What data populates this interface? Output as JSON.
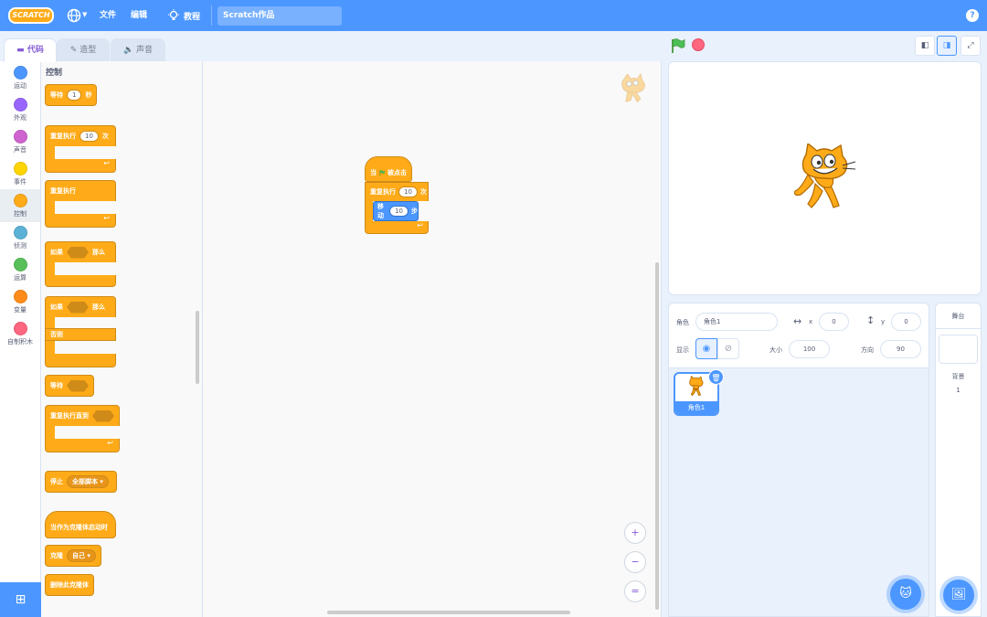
{
  "menubar": {
    "logo": "SCRATCH",
    "language_icon": "globe-icon",
    "file": "文件",
    "edit": "编辑",
    "tutorials": "教程",
    "project_title": "Scratch作品",
    "help": "?"
  },
  "tabs": [
    {
      "label": "代码",
      "icon": "code-icon"
    },
    {
      "label": "造型",
      "icon": "brush-icon"
    },
    {
      "label": "声音",
      "icon": "speaker-icon"
    }
  ],
  "categories": [
    {
      "label": "运动",
      "color": "#4c97ff"
    },
    {
      "label": "外观",
      "color": "#9966ff"
    },
    {
      "label": "声音",
      "color": "#cf63cf"
    },
    {
      "label": "事件",
      "color": "#ffd500"
    },
    {
      "label": "控制",
      "color": "#ffab19"
    },
    {
      "label": "侦测",
      "color": "#5cb1d6"
    },
    {
      "label": "运算",
      "color": "#59c059"
    },
    {
      "label": "变量",
      "color": "#ff8c1a"
    },
    {
      "label": "自制积木",
      "color": "#ff6680"
    }
  ],
  "palette": {
    "title": "控制",
    "wait": {
      "pre": "等待",
      "value": "1",
      "post": "秒"
    },
    "repeat": {
      "pre": "重复执行",
      "value": "10",
      "post": "次"
    },
    "forever": "重复执行",
    "if_then": {
      "pre": "如果",
      "post": "那么"
    },
    "if_else": {
      "pre": "如果",
      "post": "那么",
      "else": "否则"
    },
    "wait_until": "等待",
    "repeat_until": "重复执行直到",
    "stop": {
      "label": "停止",
      "option": "全部脚本"
    },
    "when_clone": "当作为克隆体启动时",
    "create_clone": {
      "label": "克隆",
      "option": "自己"
    },
    "delete_clone": "删除此克隆体"
  },
  "script": {
    "hat_pre": "当",
    "hat_post": "被点击",
    "repeat_label": "重复执行",
    "repeat_value": "10",
    "repeat_post": "次",
    "move_label": "移动",
    "move_value": "10",
    "move_post": "步"
  },
  "zoom": {
    "in": "+",
    "out": "−",
    "reset": "="
  },
  "sprite_info": {
    "sprite_label": "角色",
    "sprite_name": "角色1",
    "x_label": "x",
    "x_value": "0",
    "y_label": "y",
    "y_value": "0",
    "show_label": "显示",
    "size_label": "大小",
    "size_value": "100",
    "direction_label": "方向",
    "direction_value": "90"
  },
  "sprites": [
    {
      "name": "角色1"
    }
  ],
  "stage_panel": {
    "title": "舞台",
    "backdrop_label": "背景",
    "backdrop_count": "1"
  }
}
